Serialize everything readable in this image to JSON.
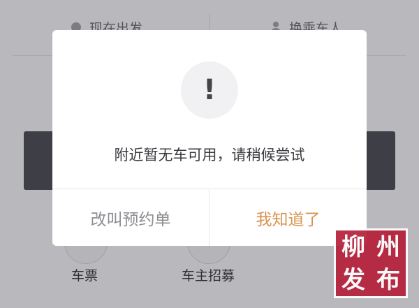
{
  "background": {
    "top_left_label": "现在出发",
    "top_right_label": "换乘车人",
    "bottom_items": [
      {
        "label": "车票"
      },
      {
        "label": "车主招募"
      }
    ]
  },
  "dialog": {
    "icon": "exclamation-icon",
    "icon_glyph": "!",
    "message": "附近暂无车可用，请稍候尝试",
    "secondary_button": "改叫预约单",
    "primary_button": "我知道了",
    "primary_color": "#d9924f"
  },
  "watermark": {
    "chars": [
      "柳",
      "州",
      "发",
      "布"
    ],
    "color": "#b5203a"
  }
}
